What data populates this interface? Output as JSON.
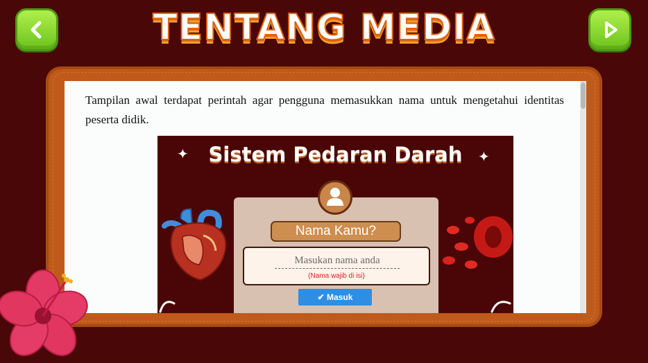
{
  "header": {
    "title": "TENTANG MEDIA",
    "back_icon": "chevron-left-icon",
    "next_icon": "play-icon",
    "button_color": "#86d62e"
  },
  "content": {
    "description": "Tampilan awal terdapat perintah agar pengguna memasukkan nama untuk mengetahui identitas peserta didik."
  },
  "preview": {
    "title": "Sistem Pedaran Darah",
    "name_label": "Nama Kamu?",
    "name_placeholder": "Masukan nama anda",
    "required_note": "(Nama wajib di isi)",
    "submit_label": "Masuk",
    "submit_icon": "check-icon",
    "background_color": "#4a0606",
    "card_color": "#d9c1b2"
  },
  "colors": {
    "background": "#4a0707",
    "frame": "#c05a1a",
    "panel": "#fbfdfd",
    "title_outline": "#e0620e"
  }
}
